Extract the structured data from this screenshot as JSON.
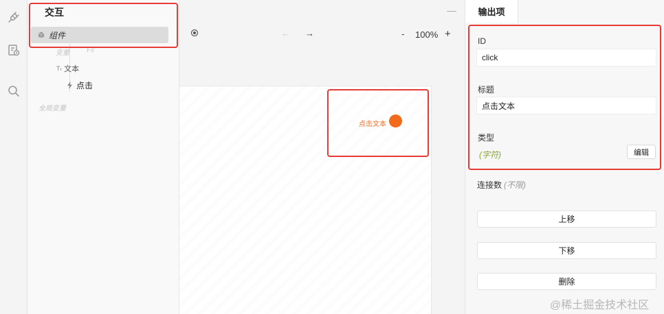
{
  "rail": {
    "icons": [
      "plug-icon",
      "file-clock-icon",
      "search-icon"
    ]
  },
  "interaction_panel": {
    "title": "交互",
    "component_label": "组件",
    "faded_variable": "变量",
    "faded_fx": "Fx",
    "text_node": "文本",
    "click_node": "点击",
    "global_vars": "全局变量"
  },
  "canvas": {
    "zoom": "100%",
    "zoom_minus": "-",
    "zoom_plus": "+",
    "collapse": "—",
    "element_text": "点击文本"
  },
  "output_panel": {
    "tab": "输出项",
    "id_label": "ID",
    "id_value": "click",
    "title_label": "标题",
    "title_value": "点击文本",
    "type_label": "类型",
    "type_value": "(字符)",
    "edit_label": "编辑",
    "connections_label": "连接数",
    "connections_value": "(不限)",
    "move_up": "上移",
    "move_down": "下移",
    "delete": "删除"
  },
  "watermark": "@稀土掘金技术社区",
  "colors": {
    "accent_orange": "#f26b1d",
    "highlight_red": "#e83a35",
    "type_green": "#8aa53a"
  }
}
